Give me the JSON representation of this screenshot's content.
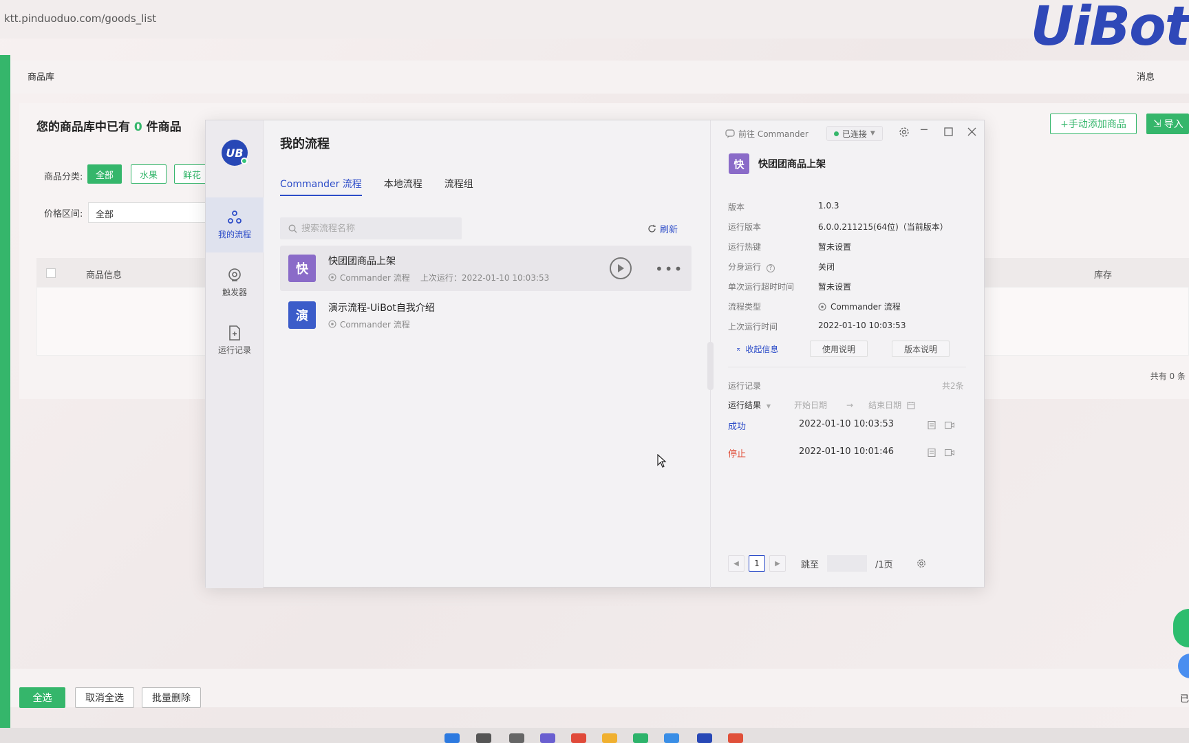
{
  "browser": {
    "url": "ktt.pinduoduo.com/goods_list",
    "brand_logo": "UiBot"
  },
  "page": {
    "breadcrumb": "商品库",
    "messages_link": "消息",
    "library_title_prefix": "您的商品库中已有",
    "library_count": "0",
    "library_title_suffix": "件商品",
    "add_product_button": "+手动添加商品",
    "import_button": "导入",
    "category_label": "商品分类:",
    "categories": [
      "全部",
      "水果",
      "鲜花"
    ],
    "price_label": "价格区间:",
    "price_value": "全部",
    "table_headers": {
      "info": "商品信息",
      "stock": "库存"
    },
    "total_text": "共有 0 条",
    "bottom_actions": {
      "select_all": "全选",
      "deselect_all": "取消全选",
      "batch_delete": "批量删除"
    },
    "right_edge_text": "已"
  },
  "uibot": {
    "logo_text": "UB",
    "sidebar": [
      {
        "label": "我的流程",
        "icon": "flow-icon"
      },
      {
        "label": "触发器",
        "icon": "trigger-icon"
      },
      {
        "label": "运行记录",
        "icon": "record-icon"
      }
    ],
    "title": "我的流程",
    "tabs": [
      "Commander 流程",
      "本地流程",
      "流程组"
    ],
    "search_placeholder": "搜索流程名称",
    "refresh_label": "刷新",
    "flows": [
      {
        "avatar": "快",
        "avatar_color": "#8a6bc8",
        "name": "快团团商品上架",
        "type": "Commander 流程",
        "last_run": "上次运行：2022-01-10 10:03:53"
      },
      {
        "avatar": "演",
        "avatar_color": "#3b5cc9",
        "name": "演示流程-UiBot自我介绍",
        "type": "Commander 流程",
        "last_run": ""
      }
    ],
    "top": {
      "goto_commander": "前往 Commander",
      "connection": "已连接"
    },
    "detail": {
      "avatar": "快",
      "title": "快团团商品上架",
      "fields": [
        {
          "key": "版本",
          "value": "1.0.3"
        },
        {
          "key": "运行版本",
          "value": "6.0.0.211215(64位)（当前版本）"
        },
        {
          "key": "运行热键",
          "value": "暂未设置"
        },
        {
          "key": "分身运行",
          "value": "关闭"
        },
        {
          "key": "单次运行超时时间",
          "value": "暂未设置"
        },
        {
          "key": "流程类型",
          "value": "Commander 流程"
        },
        {
          "key": "上次运行时间",
          "value": "2022-01-10 10:03:53"
        }
      ],
      "collapse_info": "收起信息",
      "usage_button": "使用说明",
      "version_button": "版本说明",
      "run_log_label": "运行记录",
      "run_count": "共2条",
      "result_filter": "运行结果",
      "start_date": "开始日期",
      "arrow": "→",
      "end_date": "结束日期",
      "logs": [
        {
          "status": "成功",
          "color": "#2c4cc8",
          "time": "2022-01-10 10:03:53"
        },
        {
          "status": "停止",
          "color": "#e0503a",
          "time": "2022-01-10 10:01:46"
        }
      ],
      "pager": {
        "page": "1",
        "jump_label": "跳至",
        "total_pages": "/1页"
      }
    }
  },
  "colors": {
    "accent": "#2c4cc8",
    "green": "#35b66b",
    "stop": "#e0503a"
  }
}
